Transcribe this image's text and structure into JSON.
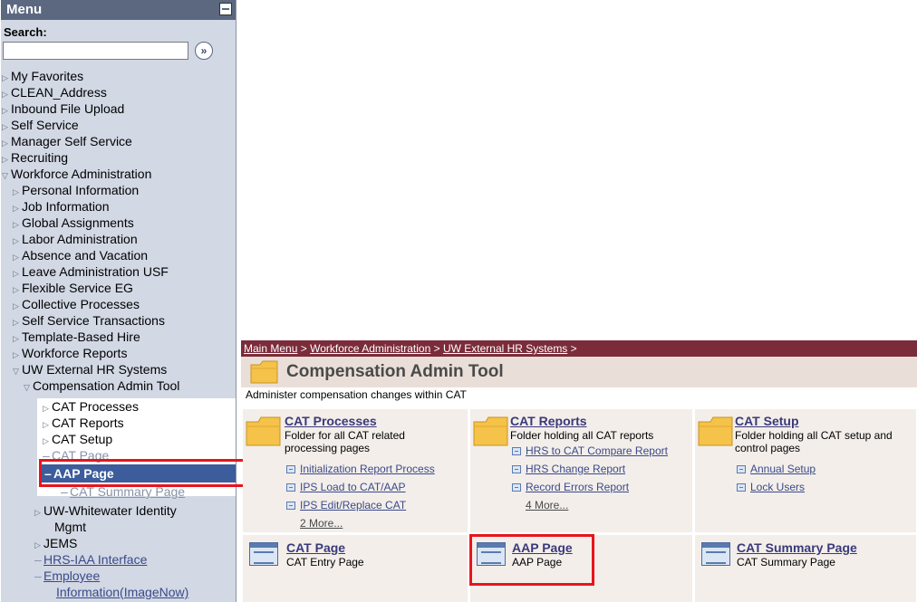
{
  "menu": {
    "title": "Menu",
    "search_label": "Search:",
    "search_value": "",
    "search_go": "»",
    "items": [
      {
        "label": "My Favorites"
      },
      {
        "label": "CLEAN_Address"
      },
      {
        "label": "Inbound File Upload"
      },
      {
        "label": "Self Service"
      },
      {
        "label": "Manager Self Service"
      },
      {
        "label": "Recruiting"
      },
      {
        "label": "Workforce Administration"
      }
    ],
    "workforce_children": [
      {
        "label": "Personal Information"
      },
      {
        "label": "Job Information"
      },
      {
        "label": "Global Assignments"
      },
      {
        "label": "Labor Administration"
      },
      {
        "label": "Absence and Vacation"
      },
      {
        "label": "Leave Administration USF"
      },
      {
        "label": "Flexible Service EG"
      },
      {
        "label": "Collective Processes"
      },
      {
        "label": "Self Service Transactions"
      },
      {
        "label": "Template-Based Hire"
      },
      {
        "label": "Workforce Reports"
      },
      {
        "label": "UW External HR Systems"
      }
    ],
    "uw_children": {
      "cat_tool": "Compensation Admin Tool",
      "cat_children": [
        {
          "label": "CAT Processes"
        },
        {
          "label": "CAT Reports"
        },
        {
          "label": "CAT Setup"
        },
        {
          "label": "CAT Page"
        },
        {
          "label": "AAP Page"
        },
        {
          "label": "CAT Summary Page"
        }
      ],
      "whitewater": "UW-Whitewater Identity",
      "whitewater_2": "Mgmt",
      "jems": "JEMS",
      "hrs_iaa": "HRS-IAA Interface",
      "employee_info": "Employee",
      "employee_info_2": "Information(ImageNow)"
    }
  },
  "breadcrumb": {
    "main_menu": "Main Menu",
    "sep": ">",
    "workforce": "Workforce Administration",
    "uw": "UW External HR Systems"
  },
  "page": {
    "title": "Compensation Admin Tool",
    "description": "Administer compensation changes within CAT"
  },
  "folders": [
    {
      "title": "CAT Processes",
      "desc": "Folder for all CAT related processing pages",
      "links": [
        "Initialization Report Process",
        "IPS Load to CAT/AAP",
        "IPS Edit/Replace CAT"
      ],
      "more": "2 More..."
    },
    {
      "title": "CAT Reports",
      "desc": "Folder holding all CAT reports",
      "links": [
        "HRS to CAT Compare Report",
        "HRS Change Report",
        "Record Errors Report"
      ],
      "more": "4 More..."
    },
    {
      "title": "CAT Setup",
      "desc": "Folder holding all CAT setup and control pages",
      "links": [
        "Annual Setup",
        "Lock Users"
      ],
      "more": ""
    }
  ],
  "pages": [
    {
      "title": "CAT Page",
      "desc": "CAT Entry Page"
    },
    {
      "title": "AAP Page",
      "desc": "AAP Page"
    },
    {
      "title": "CAT Summary Page",
      "desc": "CAT Summary Page"
    }
  ],
  "colors": {
    "highlight_red": "#e8141c",
    "breadcrumb_bg": "#7b2c3a",
    "selected_item_bg": "#3c5c9c"
  }
}
